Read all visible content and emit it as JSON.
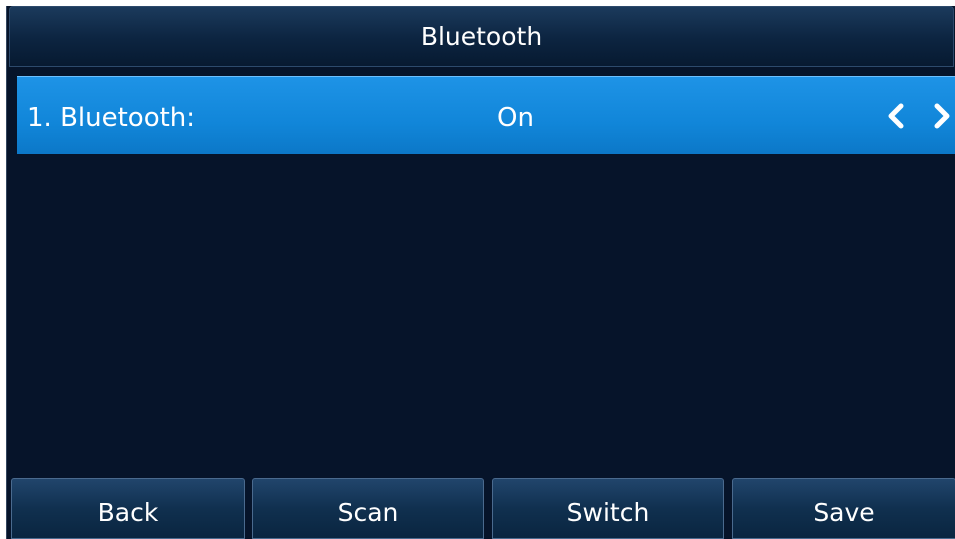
{
  "header": {
    "title": "Bluetooth"
  },
  "settings": {
    "items": [
      {
        "label": "1. Bluetooth:",
        "value": "On",
        "left_icon": "chevron-left-icon",
        "right_icon": "chevron-right-icon"
      }
    ]
  },
  "softkeys": {
    "back": "Back",
    "scan": "Scan",
    "switch": "Switch",
    "save": "Save"
  },
  "colors": {
    "background": "#06142a",
    "highlight": "#1186d9",
    "text": "#ffffff"
  }
}
